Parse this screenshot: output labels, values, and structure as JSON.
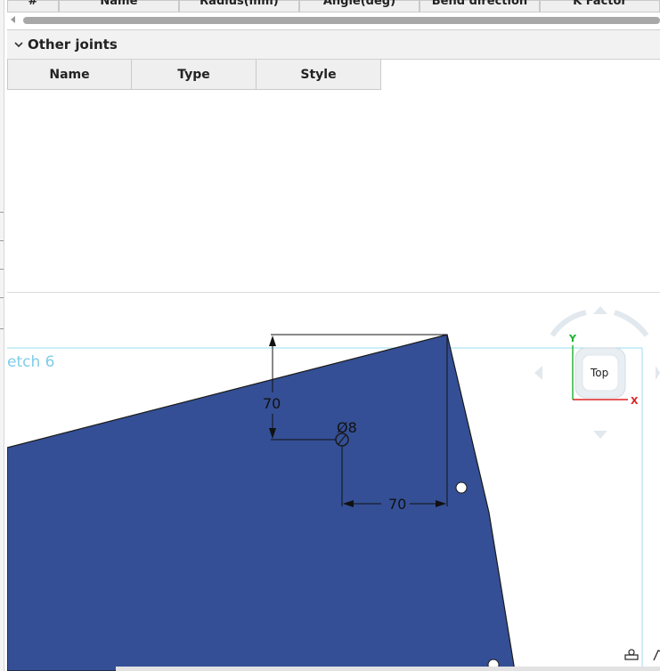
{
  "top_table": {
    "headers": [
      "#",
      "Name",
      "Radius(mm)",
      "Angle(deg)",
      "Bend direction",
      "K Factor"
    ]
  },
  "other_joints": {
    "title": "Other joints",
    "columns": [
      "Name",
      "Type",
      "Style"
    ]
  },
  "viewport": {
    "sketch_label": "etch 6",
    "dimensions": {
      "vertical": "70",
      "horizontal": "70",
      "diameter": "Ø8"
    },
    "view_cube": {
      "face": "Top",
      "axis_y": "Y",
      "axis_x": "X"
    }
  },
  "colors": {
    "part_fill": "#344f95",
    "sketch_line": "#aee3f2",
    "sketch_label": "#7fcde9"
  },
  "icons": [
    "chevron-down-icon",
    "scroll-left-icon",
    "view-cube-arrows",
    "measure-icon",
    "display-mode-icon"
  ]
}
